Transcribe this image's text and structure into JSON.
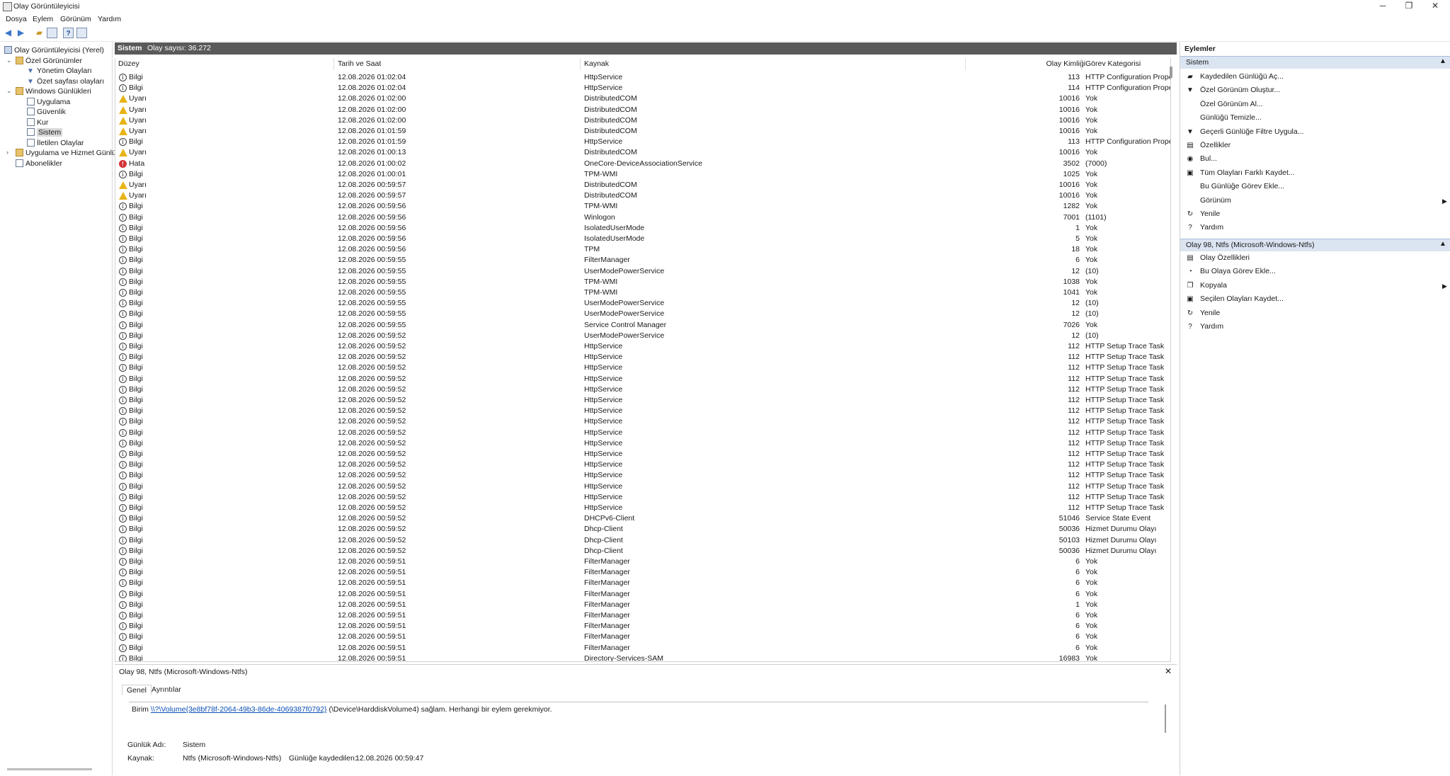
{
  "window": {
    "title": "Olay Görüntüleyicisi"
  },
  "menu": [
    "Dosya",
    "Eylem",
    "Görünüm",
    "Yardım"
  ],
  "tree": [
    {
      "label": "Olay Görüntüleyicisi (Yerel)",
      "icon": "root",
      "x": 6,
      "expand": ""
    },
    {
      "label": "Özel Görünümler",
      "icon": "folder",
      "x": 22,
      "expand": "v"
    },
    {
      "label": "Yönetim Olayları",
      "icon": "filter",
      "x": 38,
      "expand": ""
    },
    {
      "label": "Özet sayfası olayları",
      "icon": "filter",
      "x": 38,
      "expand": ""
    },
    {
      "label": "Windows Günlükleri",
      "icon": "folder",
      "x": 22,
      "expand": "v"
    },
    {
      "label": "Uygulama",
      "icon": "log",
      "x": 38,
      "expand": ""
    },
    {
      "label": "Güvenlik",
      "icon": "log",
      "x": 38,
      "expand": ""
    },
    {
      "label": "Kur",
      "icon": "log",
      "x": 38,
      "expand": ""
    },
    {
      "label": "Sistem",
      "icon": "log",
      "x": 38,
      "expand": "",
      "selected": true
    },
    {
      "label": "İletilen Olaylar",
      "icon": "log",
      "x": 38,
      "expand": ""
    },
    {
      "label": "Uygulama ve Hizmet Günlük",
      "icon": "folder",
      "x": 22,
      "expand": ">"
    },
    {
      "label": "Abonelikler",
      "icon": "log",
      "x": 22,
      "expand": ""
    }
  ],
  "center": {
    "title": "Sistem",
    "count": "Olay sayısı: 36.272"
  },
  "columns": [
    "Düzey",
    "Tarih ve Saat",
    "Kaynak",
    "Olay Kimliği",
    "Görev Kategorisi"
  ],
  "rows": [
    [
      "info",
      "Bilgi",
      "12.08.2026 01:02:04",
      "HttpService",
      "113",
      "HTTP Configuration Property Trace Task"
    ],
    [
      "info",
      "Bilgi",
      "12.08.2026 01:02:04",
      "HttpService",
      "114",
      "HTTP Configuration Property Trace Task"
    ],
    [
      "warn",
      "Uyarı",
      "12.08.2026 01:02:00",
      "DistributedCOM",
      "10016",
      "Yok"
    ],
    [
      "warn",
      "Uyarı",
      "12.08.2026 01:02:00",
      "DistributedCOM",
      "10016",
      "Yok"
    ],
    [
      "warn",
      "Uyarı",
      "12.08.2026 01:02:00",
      "DistributedCOM",
      "10016",
      "Yok"
    ],
    [
      "warn",
      "Uyarı",
      "12.08.2026 01:01:59",
      "DistributedCOM",
      "10016",
      "Yok"
    ],
    [
      "info",
      "Bilgi",
      "12.08.2026 01:01:59",
      "HttpService",
      "113",
      "HTTP Configuration Property Trace Task"
    ],
    [
      "warn",
      "Uyarı",
      "12.08.2026 01:00:13",
      "DistributedCOM",
      "10016",
      "Yok"
    ],
    [
      "err",
      "Hata",
      "12.08.2026 01:00:02",
      "OneCore-DeviceAssociationService",
      "3502",
      "(7000)"
    ],
    [
      "info",
      "Bilgi",
      "12.08.2026 01:00:01",
      "TPM-WMI",
      "1025",
      "Yok"
    ],
    [
      "warn",
      "Uyarı",
      "12.08.2026 00:59:57",
      "DistributedCOM",
      "10016",
      "Yok"
    ],
    [
      "warn",
      "Uyarı",
      "12.08.2026 00:59:57",
      "DistributedCOM",
      "10016",
      "Yok"
    ],
    [
      "info",
      "Bilgi",
      "12.08.2026 00:59:56",
      "TPM-WMI",
      "1282",
      "Yok"
    ],
    [
      "info",
      "Bilgi",
      "12.08.2026 00:59:56",
      "Winlogon",
      "7001",
      "(1101)"
    ],
    [
      "info",
      "Bilgi",
      "12.08.2026 00:59:56",
      "IsolatedUserMode",
      "1",
      "Yok"
    ],
    [
      "info",
      "Bilgi",
      "12.08.2026 00:59:56",
      "IsolatedUserMode",
      "5",
      "Yok"
    ],
    [
      "info",
      "Bilgi",
      "12.08.2026 00:59:56",
      "TPM",
      "18",
      "Yok"
    ],
    [
      "info",
      "Bilgi",
      "12.08.2026 00:59:55",
      "FilterManager",
      "6",
      "Yok"
    ],
    [
      "info",
      "Bilgi",
      "12.08.2026 00:59:55",
      "UserModePowerService",
      "12",
      "(10)"
    ],
    [
      "info",
      "Bilgi",
      "12.08.2026 00:59:55",
      "TPM-WMI",
      "1038",
      "Yok"
    ],
    [
      "info",
      "Bilgi",
      "12.08.2026 00:59:55",
      "TPM-WMI",
      "1041",
      "Yok"
    ],
    [
      "info",
      "Bilgi",
      "12.08.2026 00:59:55",
      "UserModePowerService",
      "12",
      "(10)"
    ],
    [
      "info",
      "Bilgi",
      "12.08.2026 00:59:55",
      "UserModePowerService",
      "12",
      "(10)"
    ],
    [
      "info",
      "Bilgi",
      "12.08.2026 00:59:55",
      "Service Control Manager",
      "7026",
      "Yok"
    ],
    [
      "info",
      "Bilgi",
      "12.08.2026 00:59:52",
      "UserModePowerService",
      "12",
      "(10)"
    ],
    [
      "info",
      "Bilgi",
      "12.08.2026 00:59:52",
      "HttpService",
      "112",
      "HTTP Setup Trace Task"
    ],
    [
      "info",
      "Bilgi",
      "12.08.2026 00:59:52",
      "HttpService",
      "112",
      "HTTP Setup Trace Task"
    ],
    [
      "info",
      "Bilgi",
      "12.08.2026 00:59:52",
      "HttpService",
      "112",
      "HTTP Setup Trace Task"
    ],
    [
      "info",
      "Bilgi",
      "12.08.2026 00:59:52",
      "HttpService",
      "112",
      "HTTP Setup Trace Task"
    ],
    [
      "info",
      "Bilgi",
      "12.08.2026 00:59:52",
      "HttpService",
      "112",
      "HTTP Setup Trace Task"
    ],
    [
      "info",
      "Bilgi",
      "12.08.2026 00:59:52",
      "HttpService",
      "112",
      "HTTP Setup Trace Task"
    ],
    [
      "info",
      "Bilgi",
      "12.08.2026 00:59:52",
      "HttpService",
      "112",
      "HTTP Setup Trace Task"
    ],
    [
      "info",
      "Bilgi",
      "12.08.2026 00:59:52",
      "HttpService",
      "112",
      "HTTP Setup Trace Task"
    ],
    [
      "info",
      "Bilgi",
      "12.08.2026 00:59:52",
      "HttpService",
      "112",
      "HTTP Setup Trace Task"
    ],
    [
      "info",
      "Bilgi",
      "12.08.2026 00:59:52",
      "HttpService",
      "112",
      "HTTP Setup Trace Task"
    ],
    [
      "info",
      "Bilgi",
      "12.08.2026 00:59:52",
      "HttpService",
      "112",
      "HTTP Setup Trace Task"
    ],
    [
      "info",
      "Bilgi",
      "12.08.2026 00:59:52",
      "HttpService",
      "112",
      "HTTP Setup Trace Task"
    ],
    [
      "info",
      "Bilgi",
      "12.08.2026 00:59:52",
      "HttpService",
      "112",
      "HTTP Setup Trace Task"
    ],
    [
      "info",
      "Bilgi",
      "12.08.2026 00:59:52",
      "HttpService",
      "112",
      "HTTP Setup Trace Task"
    ],
    [
      "info",
      "Bilgi",
      "12.08.2026 00:59:52",
      "HttpService",
      "112",
      "HTTP Setup Trace Task"
    ],
    [
      "info",
      "Bilgi",
      "12.08.2026 00:59:52",
      "HttpService",
      "112",
      "HTTP Setup Trace Task"
    ],
    [
      "info",
      "Bilgi",
      "12.08.2026 00:59:52",
      "DHCPv6-Client",
      "51046",
      "Service State Event"
    ],
    [
      "info",
      "Bilgi",
      "12.08.2026 00:59:52",
      "Dhcp-Client",
      "50036",
      "Hizmet Durumu Olayı"
    ],
    [
      "info",
      "Bilgi",
      "12.08.2026 00:59:52",
      "Dhcp-Client",
      "50103",
      "Hizmet Durumu Olayı"
    ],
    [
      "info",
      "Bilgi",
      "12.08.2026 00:59:52",
      "Dhcp-Client",
      "50036",
      "Hizmet Durumu Olayı"
    ],
    [
      "info",
      "Bilgi",
      "12.08.2026 00:59:51",
      "FilterManager",
      "6",
      "Yok"
    ],
    [
      "info",
      "Bilgi",
      "12.08.2026 00:59:51",
      "FilterManager",
      "6",
      "Yok"
    ],
    [
      "info",
      "Bilgi",
      "12.08.2026 00:59:51",
      "FilterManager",
      "6",
      "Yok"
    ],
    [
      "info",
      "Bilgi",
      "12.08.2026 00:59:51",
      "FilterManager",
      "6",
      "Yok"
    ],
    [
      "info",
      "Bilgi",
      "12.08.2026 00:59:51",
      "FilterManager",
      "1",
      "Yok"
    ],
    [
      "info",
      "Bilgi",
      "12.08.2026 00:59:51",
      "FilterManager",
      "6",
      "Yok"
    ],
    [
      "info",
      "Bilgi",
      "12.08.2026 00:59:51",
      "FilterManager",
      "6",
      "Yok"
    ],
    [
      "info",
      "Bilgi",
      "12.08.2026 00:59:51",
      "FilterManager",
      "6",
      "Yok"
    ],
    [
      "info",
      "Bilgi",
      "12.08.2026 00:59:51",
      "FilterManager",
      "6",
      "Yok"
    ],
    [
      "info",
      "Bilgi",
      "12.08.2026 00:59:51",
      "Directory-Services-SAM",
      "16983",
      "Yok"
    ]
  ],
  "detail": {
    "title": "Olay 98, Ntfs (Microsoft-Windows-Ntfs)",
    "tabs": [
      "Genel",
      "Ayrıntılar"
    ],
    "msg_pre": "Birim ",
    "msg_link": "\\\\?\\Volume{3e8bf78f-2064-49b3-86de-4069387f0792}",
    "msg_post": " (\\Device\\HarddiskVolume4) sağlam. Herhangi bir eylem gerekmiyor.",
    "log_name_label": "Günlük Adı:",
    "log_name_value": "Sistem",
    "source_label": "Kaynak:",
    "source_value": "Ntfs (Microsoft-Windows-Ntfs)",
    "logged_label": "Günlüğe kaydedilen:",
    "logged_value": "12.08.2026 00:59:47"
  },
  "actions": {
    "title": "Eylemler",
    "section1": "Sistem",
    "items1": [
      {
        "label": "Kaydedilen Günlüğü Aç...",
        "icon": "open-folder-icon",
        "glyph": "▰"
      },
      {
        "label": "Özel Görünüm Oluştur...",
        "icon": "filter-icon",
        "glyph": "▼"
      },
      {
        "label": "Özel Görünüm Al...",
        "icon": "",
        "glyph": ""
      },
      {
        "label": "Günlüğü Temizle...",
        "icon": "",
        "glyph": ""
      },
      {
        "label": "Geçerli Günlüğe Filtre Uygula...",
        "icon": "filter-icon",
        "glyph": "▼"
      },
      {
        "label": "Özellikler",
        "icon": "properties-icon",
        "glyph": "▤"
      },
      {
        "label": "Bul...",
        "icon": "binoculars-icon",
        "glyph": "◉"
      },
      {
        "label": "Tüm Olayları Farklı Kaydet...",
        "icon": "save-icon",
        "glyph": "▣"
      },
      {
        "label": "Bu Günlüğe Görev Ekle...",
        "icon": "",
        "glyph": ""
      },
      {
        "label": "Görünüm",
        "icon": "",
        "glyph": "",
        "arrow": "▶"
      },
      {
        "label": "Yenile",
        "icon": "refresh-icon",
        "glyph": "↻"
      },
      {
        "label": "Yardım",
        "icon": "help-icon",
        "glyph": "?"
      }
    ],
    "section2": "Olay 98, Ntfs (Microsoft-Windows-Ntfs)",
    "items2": [
      {
        "label": "Olay Özellikleri",
        "icon": "properties-icon",
        "glyph": "▤"
      },
      {
        "label": "Bu Olaya Görev Ekle...",
        "icon": "task-icon",
        "glyph": "◔"
      },
      {
        "label": "Kopyala",
        "icon": "copy-icon",
        "glyph": "❐",
        "arrow": "▶"
      },
      {
        "label": "Seçilen Olayları Kaydet...",
        "icon": "save-icon",
        "glyph": "▣"
      },
      {
        "label": "Yenile",
        "icon": "refresh-icon",
        "glyph": "↻"
      },
      {
        "label": "Yardım",
        "icon": "help-icon",
        "glyph": "?"
      }
    ]
  }
}
